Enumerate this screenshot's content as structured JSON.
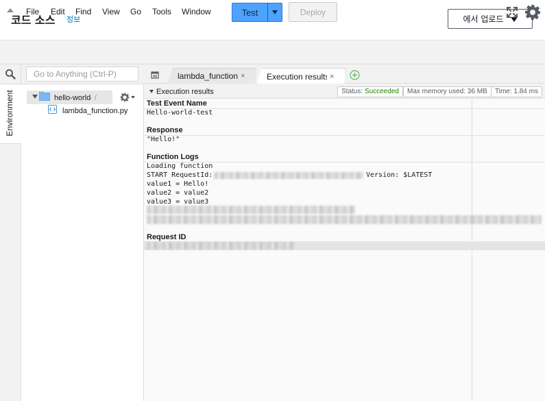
{
  "header": {
    "title": "코드 소스",
    "info_link": "정보",
    "upload_button": "에서 업로드"
  },
  "menu": {
    "items": [
      "File",
      "Edit",
      "Find",
      "View",
      "Go",
      "Tools",
      "Window"
    ]
  },
  "toolbar": {
    "test_label": "Test",
    "deploy_label": "Deploy"
  },
  "sidebar": {
    "env_tab": "Environment",
    "goto_placeholder": "Go to Anything (Ctrl-P)"
  },
  "tree": {
    "folder_name": "hello-world",
    "folder_path": "- /",
    "file_name": "lambda_function.py"
  },
  "tabs": [
    {
      "label": "lambda_function",
      "close": "×"
    },
    {
      "label": "Execution results",
      "close": "×"
    }
  ],
  "results": {
    "title": "Execution results",
    "status_label": "Status:",
    "status_value": "Succeeded",
    "memory": "Max memory used: 36 MB",
    "time": "Time: 1.84 ms",
    "test_event_heading": "Test Event Name",
    "test_event_value": "Hello-world-test",
    "response_heading": "Response",
    "response_value": "\"Hello!\"",
    "logs_heading": "Function Logs",
    "logs": {
      "line1": "Loading function",
      "start_prefix": "START RequestId:",
      "start_suffix": "Version: $LATEST",
      "line3": "value1 = Hello!",
      "line4": "value2 = value2",
      "line5": "value3 = value3"
    },
    "request_id_heading": "Request ID"
  },
  "colors": {
    "accent": "#4da3ff",
    "status_success": "#1d8102",
    "link": "#0073bb"
  },
  "icons": [
    "search-icon",
    "expand-icon",
    "gear-icon",
    "folder-icon",
    "python-file-icon",
    "tab-menu-icon",
    "add-tab-icon"
  ]
}
